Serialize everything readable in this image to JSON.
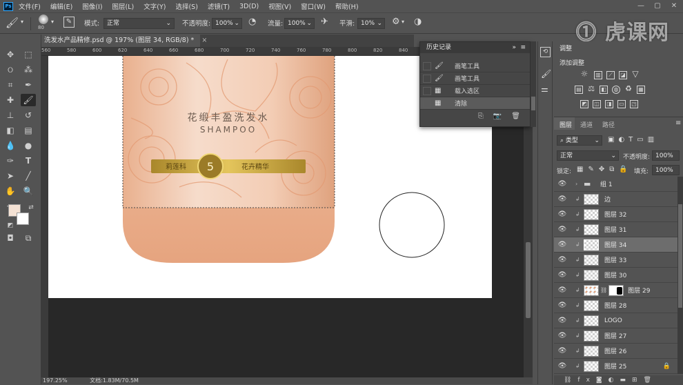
{
  "menu": [
    "文件(F)",
    "编辑(E)",
    "图像(I)",
    "图层(L)",
    "文字(Y)",
    "选择(S)",
    "滤镜(T)",
    "3D(D)",
    "视图(V)",
    "窗口(W)",
    "帮助(H)"
  ],
  "options": {
    "brush_size": "80",
    "mode_label": "模式:",
    "mode_value": "正常",
    "opacity_label": "不透明度:",
    "opacity_value": "100%",
    "flow_label": "流量:",
    "flow_value": "100%",
    "smooth_label": "平滑:",
    "smooth_value": "10%"
  },
  "document_tab": "洗发水产品精修.psd @ 197% (图层 34, RGB/8) *",
  "ruler_ticks": [
    "560",
    "580",
    "600",
    "620",
    "640",
    "660",
    "680",
    "700",
    "720",
    "740",
    "760",
    "780",
    "800",
    "820",
    "840",
    "860",
    "880",
    "900"
  ],
  "status": {
    "zoom": "197.25%",
    "doc": "文档:1.83M/70.5M"
  },
  "product": {
    "title_cn": "花缎丰盈洗发水",
    "title_en": "SHAMPOO",
    "badge_number": "5",
    "badge_left": "莉莲科",
    "badge_right": "花卉精华"
  },
  "history": {
    "title": "历史记录",
    "items": [
      {
        "label": "画笔工具",
        "icon": "brush-icon"
      },
      {
        "label": "画笔工具",
        "icon": "brush-icon"
      },
      {
        "label": "载入选区",
        "icon": "document-icon"
      },
      {
        "label": "清除",
        "icon": "document-icon"
      }
    ]
  },
  "adjustments": {
    "tab": "调整",
    "add_label": "添加调整"
  },
  "layers_panel": {
    "tabs": [
      "图层",
      "通道",
      "路径"
    ],
    "filter_kind": "类型",
    "blend_mode": "正常",
    "opacity_label": "不透明度:",
    "opacity_value": "100%",
    "lock_label": "锁定:",
    "fill_label": "填充:",
    "fill_value": "100%",
    "layers": [
      {
        "name": "组 1",
        "type": "group"
      },
      {
        "name": "边",
        "type": "layer"
      },
      {
        "name": "图层 32",
        "type": "layer"
      },
      {
        "name": "图层 31",
        "type": "layer"
      },
      {
        "name": "图层 34",
        "type": "layer",
        "selected": true
      },
      {
        "name": "图层 33",
        "type": "layer"
      },
      {
        "name": "图层 30",
        "type": "layer"
      },
      {
        "name": "图层 29",
        "type": "masked"
      },
      {
        "name": "图层 28",
        "type": "layer"
      },
      {
        "name": "LOGO",
        "type": "layer"
      },
      {
        "name": "图层 27",
        "type": "layer"
      },
      {
        "name": "图层 26",
        "type": "layer"
      },
      {
        "name": "图层 25",
        "type": "layer"
      }
    ]
  },
  "watermark": "虎课网",
  "colors": {
    "foreground": "#f5e2d4",
    "background": "#ffffff",
    "accent_bottle": "#e9a882"
  }
}
